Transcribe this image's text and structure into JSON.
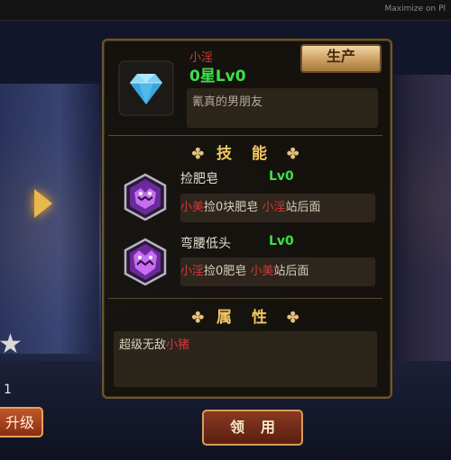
{
  "window": {
    "maximize_label": "Maximize on Pl"
  },
  "item": {
    "name": "小淫",
    "level": "0星Lv0",
    "description": "氰真的男朋友",
    "generate_label": "生产"
  },
  "skills_section": {
    "title": "技 能",
    "ornament": "✤"
  },
  "skills": [
    {
      "name": "捡肥皂",
      "level": "Lv0",
      "desc_parts": [
        "小美",
        "捡0块肥皂",
        "小淫",
        "站后面"
      ]
    },
    {
      "name": "弯腰低头",
      "level": "Lv0",
      "desc_parts": [
        "小淫",
        "捡0肥皂",
        "小美",
        "站后面"
      ]
    }
  ],
  "attributes_section": {
    "title": "属 性",
    "ornament": "✤"
  },
  "attributes": {
    "prefix": "超级无敌",
    "highlight": "小猪"
  },
  "claim_label": "领用",
  "left_panel": {
    "star_icon": "★",
    "level": "1",
    "upgrade_label": "升级"
  },
  "colors": {
    "green_level": "#3de04a",
    "red_name": "#d23a3a",
    "gold_heading": "#f2c764",
    "panel_border": "#6a5534"
  },
  "icons": [
    "diamond-gem-icon",
    "purple-monster-skill-icon",
    "star-icon",
    "arrow-right-icon"
  ]
}
